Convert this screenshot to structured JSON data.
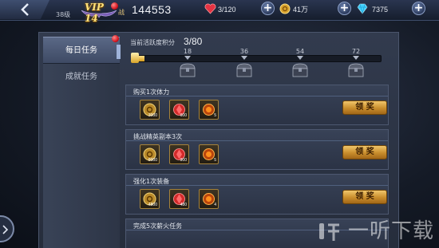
{
  "header": {
    "vip": "VIP 14",
    "level": "38级",
    "power_label": "战",
    "power": "144553",
    "stamina": "3/120",
    "gold": "41万",
    "diamonds": "7375"
  },
  "tabs": [
    {
      "label": "每日任务",
      "active": true
    },
    {
      "label": "成就任务",
      "active": false
    }
  ],
  "activity": {
    "label": "当前活跃度积分",
    "value": "3/80",
    "progress": 0.0375,
    "milestones": [
      "18",
      "36",
      "54",
      "72"
    ]
  },
  "quests": [
    {
      "title": "购买1次体力",
      "rewards": [
        "3000",
        "600",
        "5"
      ],
      "button": "领 奖"
    },
    {
      "title": "挑战精英副本3次",
      "rewards": [
        "8000",
        "900",
        "5"
      ],
      "button": "领 奖"
    },
    {
      "title": "强化1次装备",
      "rewards": [
        "4800",
        "480",
        "4"
      ],
      "button": "领 奖"
    },
    {
      "title": "完成5次薪火任务",
      "rewards": [],
      "button": ""
    }
  ],
  "watermark": "一听下载",
  "colors": {
    "accent": "#e8b44a",
    "panel": "#323b4e",
    "notify": "#d0101a"
  }
}
